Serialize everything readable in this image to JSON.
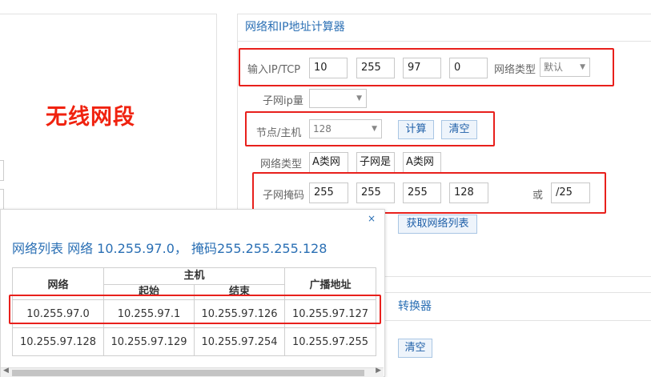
{
  "annotation": "无线网段",
  "calculator": {
    "title": "网络和IP地址计算器",
    "ip_label": "输入IP/TCP",
    "ip_octets": [
      "10",
      "255",
      "97",
      "0"
    ],
    "net_type_label": "网络类型",
    "net_type_select": "默认",
    "subnet_count_label": "子网ip量",
    "subnet_count_select": "",
    "hosts_label": "节点/主机",
    "hosts_select": "128",
    "calc_button": "计算",
    "clear_button": "清空",
    "class_label": "网络类型",
    "class_values": [
      "A类网",
      "子网是",
      "A类网"
    ],
    "mask_label": "子网掩码",
    "mask_octets": [
      "255",
      "255",
      "255",
      "128"
    ],
    "or_label": "或",
    "cidr": "/25",
    "get_list_button": "获取网络列表"
  },
  "popup": {
    "close": "×",
    "title": "网络列表  网络 10.255.97.0， 掩码255.255.255.128",
    "headers": {
      "network": "网络",
      "host": "主机",
      "start": "起始",
      "end": "结束",
      "broadcast": "广播地址"
    },
    "rows": [
      {
        "network": "10.255.97.0",
        "start": "10.255.97.1",
        "end": "10.255.97.126",
        "broadcast": "10.255.97.127"
      },
      {
        "network": "10.255.97.128",
        "start": "10.255.97.129",
        "end": "10.255.97.254",
        "broadcast": "10.255.97.255"
      }
    ],
    "scroll_left": "◀",
    "scroll_right": "▶"
  },
  "converter": {
    "title": "转换器",
    "clear_button": "清空"
  },
  "colors": {
    "accent": "#2a6fb4",
    "annotation_red": "#e8201c"
  }
}
